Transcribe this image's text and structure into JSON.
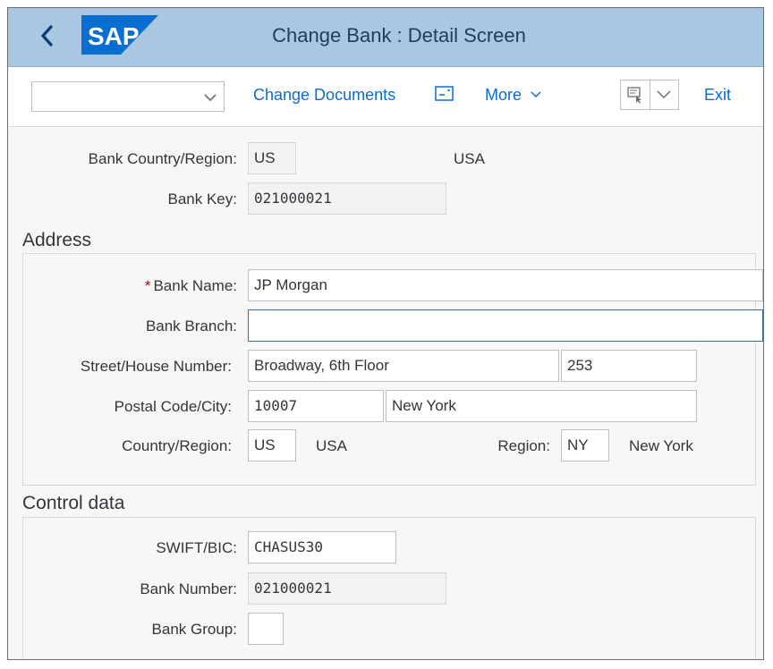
{
  "shell": {
    "title": "Change Bank : Detail Screen",
    "logo_text": "SAP",
    "brand_color": "#0a6ed1"
  },
  "toolbar": {
    "variant_value": "",
    "change_documents": "Change Documents",
    "more": "More",
    "exit": "Exit"
  },
  "header_fields": {
    "bank_country_label": "Bank Country/Region:",
    "bank_country_value": "US",
    "bank_country_text": "USA",
    "bank_key_label": "Bank Key:",
    "bank_key_value": "021000021"
  },
  "address": {
    "title": "Address",
    "bank_name_label": "Bank Name:",
    "bank_name_value": "JP Morgan",
    "bank_branch_label": "Bank Branch:",
    "bank_branch_value": "",
    "street_label": "Street/House Number:",
    "street_value": "Broadway, 6th Floor",
    "house_number_value": "253",
    "postal_label": "Postal Code/City:",
    "postal_value": "10007",
    "city_value": "New York",
    "country_label": "Country/Region:",
    "country_value": "US",
    "country_text": "USA",
    "region_label": "Region:",
    "region_value": "NY",
    "region_text": "New York"
  },
  "control": {
    "title": "Control data",
    "swift_label": "SWIFT/BIC:",
    "swift_value": "CHASUS30",
    "bank_number_label": "Bank Number:",
    "bank_number_value": "021000021",
    "bank_group_label": "Bank Group:",
    "bank_group_value": ""
  }
}
